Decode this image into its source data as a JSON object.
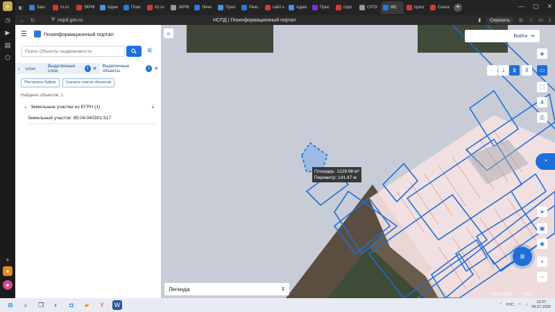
{
  "browser": {
    "tabs": [
      {
        "label": "Закс",
        "color": "#3c7bd6"
      },
      {
        "label": "rn.ru",
        "color": "#d43b2f"
      },
      {
        "label": "ЗКРФ",
        "color": "#d43b2f"
      },
      {
        "label": "Адми",
        "color": "#4a90e2"
      },
      {
        "label": "Поис",
        "color": "#2b7ae0"
      },
      {
        "label": "rtz.ru",
        "color": "#d43b2f"
      },
      {
        "label": "ЗКРФ",
        "color": "#999999"
      },
      {
        "label": "Личн",
        "color": "#2b7ae0"
      },
      {
        "label": "Прил",
        "color": "#4a90e2"
      },
      {
        "label": "Реес",
        "color": "#2b7ae0"
      },
      {
        "label": "сайт к",
        "color": "#d43b2f"
      },
      {
        "label": "Адми",
        "color": "#4a90e2"
      },
      {
        "label": "Прос",
        "color": "#8a2be2"
      },
      {
        "label": "горо",
        "color": "#d43b2f"
      },
      {
        "label": "СРЗУ",
        "color": "#999999"
      },
      {
        "label": "НС",
        "color": "#2b7ae0"
      },
      {
        "label": "присг",
        "color": "#d43b2f"
      },
      {
        "label": "Скача",
        "color": "#d43b2f"
      }
    ],
    "url": "nspd.gov.ru",
    "page_title": "НСПД | Геоинформационный портал",
    "ask_label": "Спросить"
  },
  "panel": {
    "title": "Геоинформационный портал",
    "search_placeholder": "Поиск Объекты недвижимости",
    "tabs": [
      {
        "label": "слои"
      },
      {
        "label": "Выделенные слои",
        "badge": "1"
      },
      {
        "label": "Выделенные объекты",
        "badge": "1"
      }
    ],
    "buttons": {
      "buffer": "Построить буфер",
      "download_list": "Скачать список объектов"
    },
    "found": "Найдено объектов: 1",
    "group": "Земельные участки из ЕГРН (1)",
    "item": "Земельный участок: 85:04:040301:517"
  },
  "map": {
    "login": "Войти",
    "measure": {
      "area": "Площадь: 1229.98 м²",
      "perimeter": "Периметр: 141.47 м"
    },
    "legend": "Легенда",
    "copyright": "НСПД 2025",
    "scale": "100 м"
  },
  "taskbar": {
    "lang": "РУС",
    "time": "13:27",
    "date": "05.07.2025"
  }
}
